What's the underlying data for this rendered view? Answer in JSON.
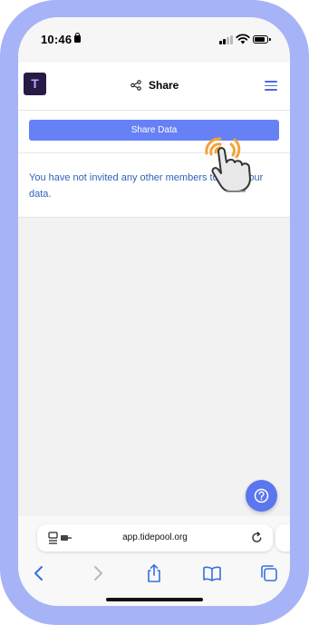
{
  "status_bar": {
    "time": "10:46"
  },
  "header": {
    "title": "Share",
    "logo_letter": "T"
  },
  "share": {
    "button_label": "Share Data",
    "info_text": "You have not invited any other members to view your data."
  },
  "browser": {
    "url": "app.tidepool.org"
  },
  "colors": {
    "frame": "#a6b3f7",
    "accent": "#6681f6",
    "info_text": "#2f63b8",
    "logo_bg": "#271b46"
  },
  "icons": {
    "share": "share-icon",
    "menu": "menu-icon",
    "help": "help-icon",
    "reload": "reload-icon",
    "tap": "tap-gesture-icon"
  }
}
